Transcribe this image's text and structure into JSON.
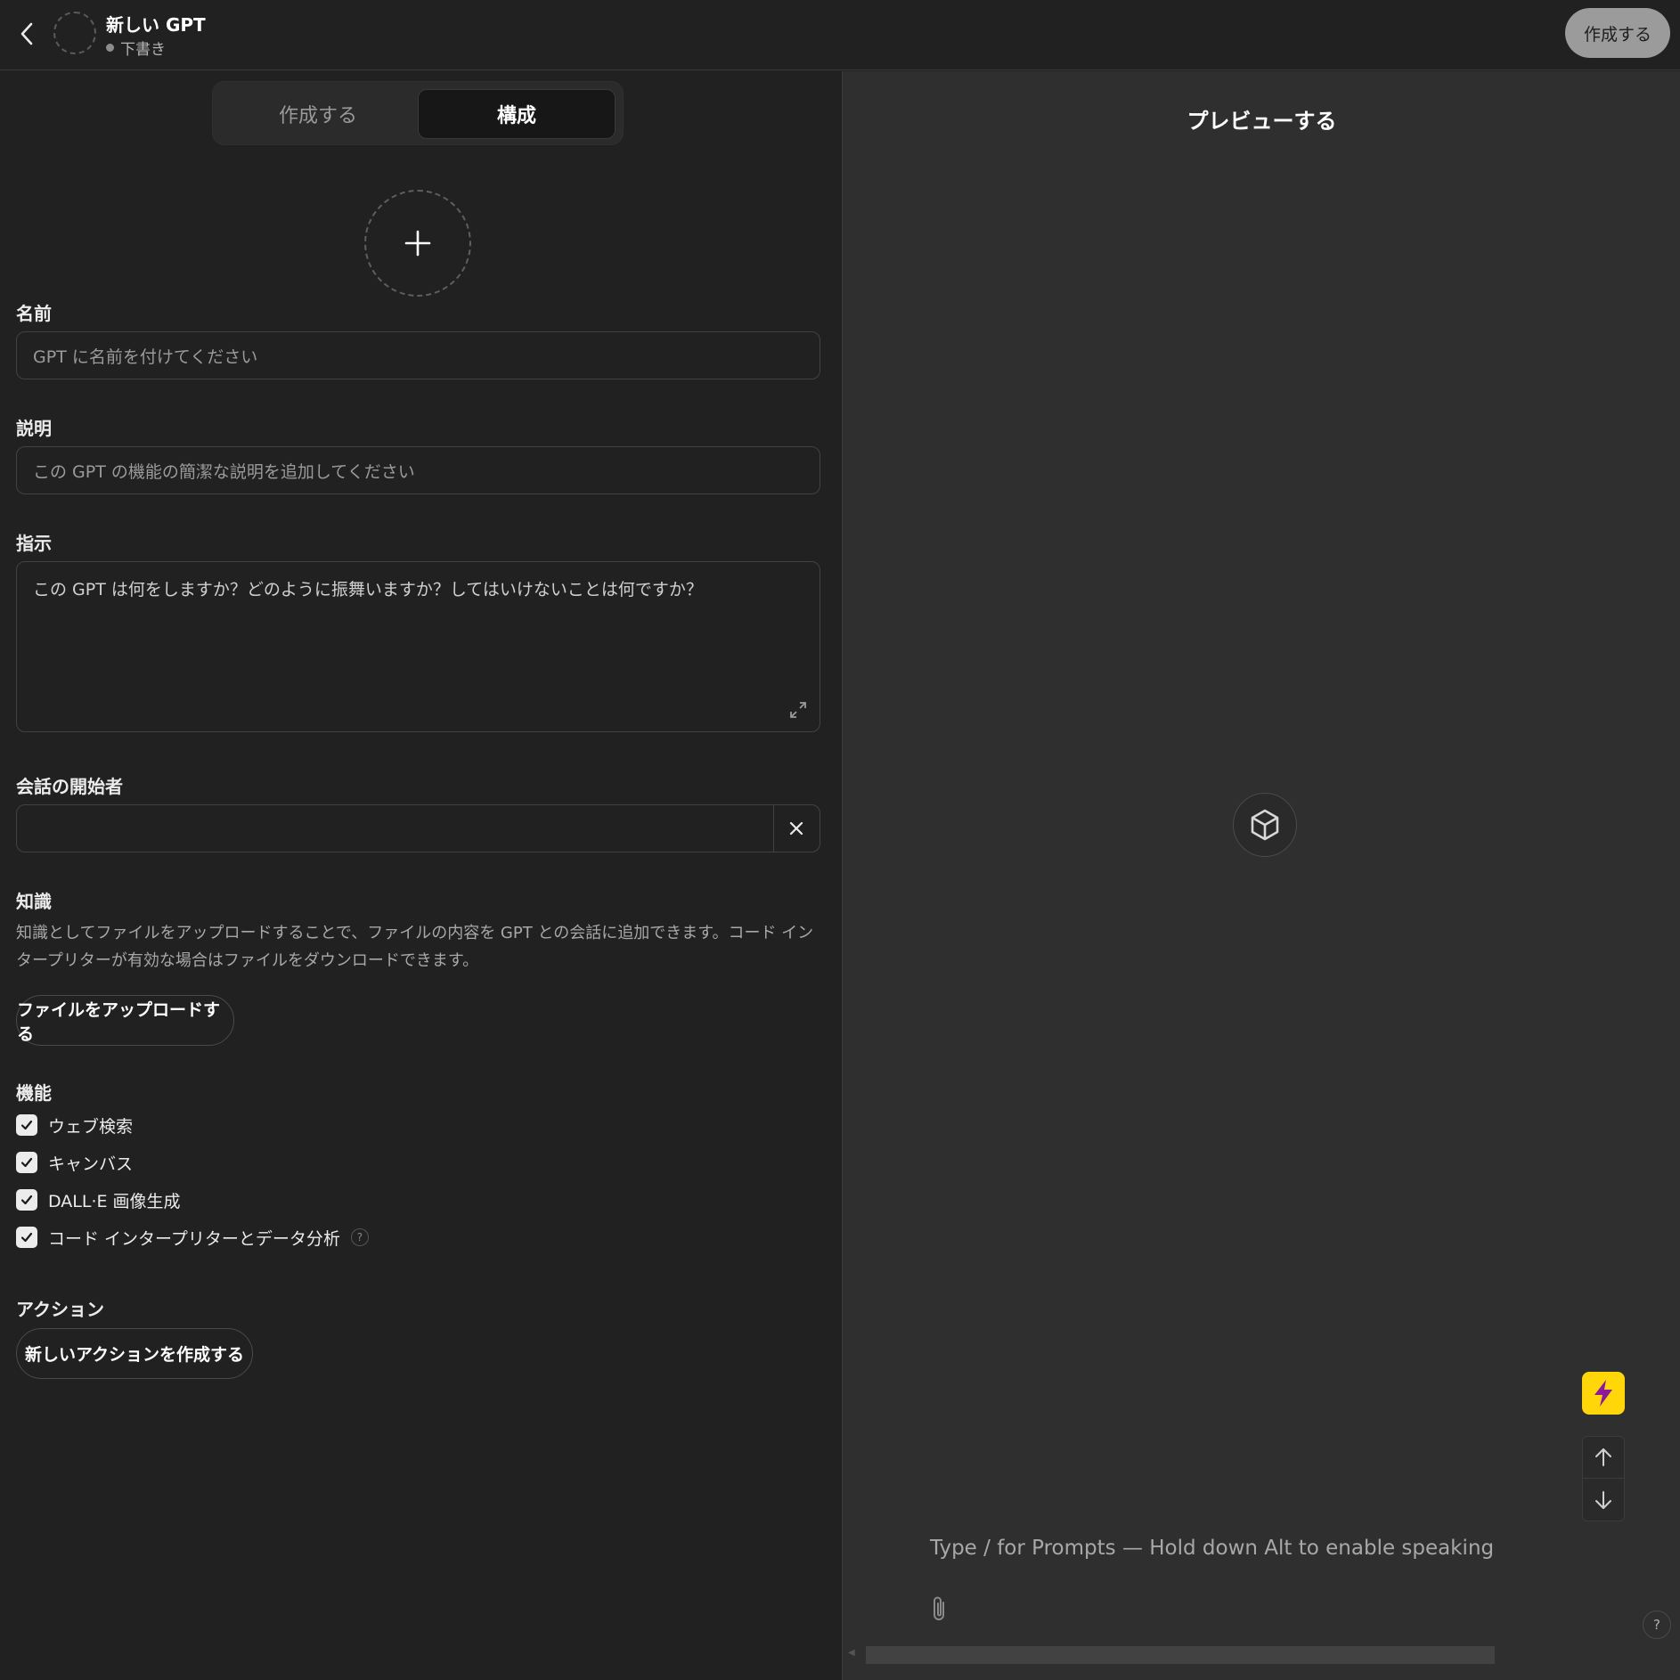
{
  "header": {
    "title": "新しい GPT",
    "status": "下書き",
    "publish_label": "作成する"
  },
  "tabs": {
    "create_label": "作成する",
    "configure_label": "構成",
    "active": "構成"
  },
  "form": {
    "name": {
      "label": "名前",
      "placeholder": "GPT に名前を付けてください",
      "value": ""
    },
    "description": {
      "label": "説明",
      "placeholder": "この GPT の機能の簡潔な説明を追加してください",
      "value": ""
    },
    "instructions": {
      "label": "指示",
      "placeholder": "この GPT は何をしますか？どのように振舞いますか？してはいけないことは何ですか？",
      "value": ""
    },
    "starters": {
      "label": "会話の開始者",
      "value": ""
    },
    "knowledge": {
      "label": "知識",
      "description": "知識としてファイルをアップロードすることで、ファイルの内容を GPT との会話に追加できます。コード インタープリターが有効な場合はファイルをダウンロードできます。",
      "upload_label": "ファイルをアップロードする"
    },
    "capabilities": {
      "label": "機能",
      "items": [
        {
          "label": "ウェブ検索",
          "checked": true
        },
        {
          "label": "キャンバス",
          "checked": true
        },
        {
          "label": "DALL·E 画像生成",
          "checked": true
        },
        {
          "label": "コード インタープリターとデータ分析",
          "checked": true,
          "has_help": true
        }
      ],
      "help_glyph": "?"
    },
    "actions": {
      "label": "アクション",
      "create_label": "新しいアクションを作成する"
    }
  },
  "preview": {
    "title": "プレビューする",
    "composer_placeholder": "Type / for Prompts — Hold down Alt to enable speaking",
    "help_glyph": "?"
  },
  "icons": {
    "back": "chevron-left-icon",
    "add_avatar": "plus-icon",
    "expand": "expand-icon",
    "remove": "close-icon",
    "check": "checkmark-icon",
    "preview_logo": "cube-icon",
    "bolt": "lightning-bolt-icon",
    "scroll_up": "arrow-up-icon",
    "scroll_down": "arrow-down-icon",
    "attach": "paperclip-icon"
  },
  "colors": {
    "background": "#212121",
    "preview_background": "#2f2f2f",
    "publish_button": "#9b9b9b",
    "bolt_button": "#ffd60a",
    "bolt_glyph": "#8b1a9b"
  }
}
